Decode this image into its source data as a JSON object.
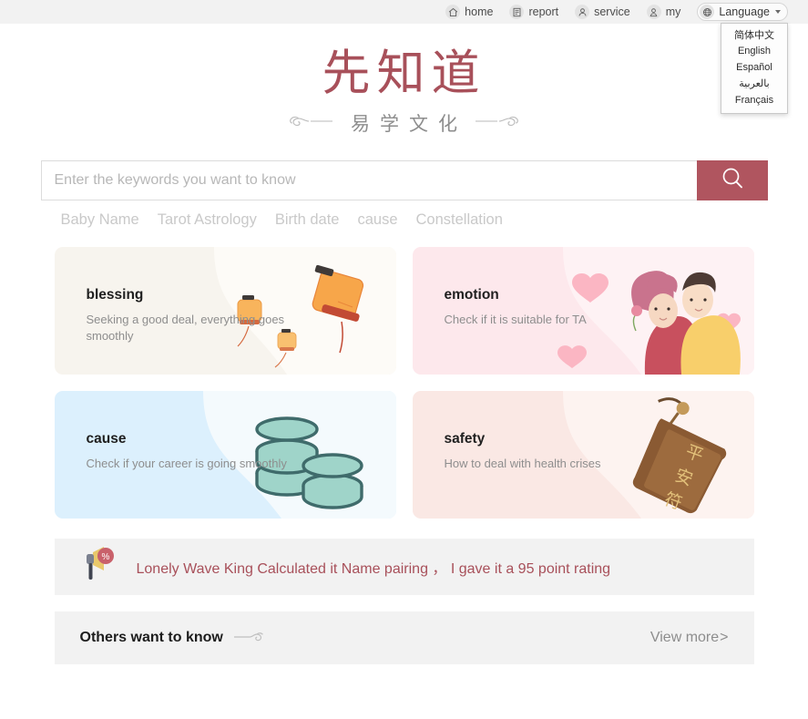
{
  "topnav": {
    "items": [
      {
        "label": "home",
        "icon": "home-icon"
      },
      {
        "label": "report",
        "icon": "report-icon"
      },
      {
        "label": "service",
        "icon": "service-icon"
      },
      {
        "label": "my",
        "icon": "user-icon"
      }
    ],
    "language_button": {
      "label": "Language",
      "icon": "globe-icon",
      "caret": "chevron-down-icon"
    },
    "language_menu": {
      "open": true,
      "options": [
        "简体中文",
        "English",
        "Español",
        "بالعربية",
        "Français"
      ]
    }
  },
  "logo": {
    "main": "先知道",
    "sub": "易学文化",
    "decoration": "cloud-ornament"
  },
  "search": {
    "placeholder": "Enter the keywords you want to know",
    "value": "",
    "button_icon": "search-icon",
    "button_color": "#b0555f"
  },
  "quick_tags": [
    "Baby Name",
    "Tarot Astrology",
    "Birth date",
    "cause",
    "Constellation"
  ],
  "cards": [
    {
      "title": "blessing",
      "desc": "Seeking a good deal, everything goes smoothly",
      "bg": "#f7f4ee",
      "art": "lanterns-illustration"
    },
    {
      "title": "emotion",
      "desc": "Check if it is suitable for TA",
      "bg": "#fde8ec",
      "art": "couple-hearts-illustration"
    },
    {
      "title": "cause",
      "desc": "Check if your career is going smoothly",
      "bg": "#dcf0fd",
      "art": "coin-stacks-illustration"
    },
    {
      "title": "safety",
      "desc": "How to deal with health crises",
      "bg": "#fae8e4",
      "art": "amulet-illustration",
      "art_text": "平安符"
    }
  ],
  "announcement": {
    "icon": "megaphone-percent-icon",
    "text": "Lonely Wave King Calculated it  Name pairing ， I gave it a 95 point rating",
    "color": "#a8505a"
  },
  "others_section": {
    "title": "Others want to know",
    "decoration": "cloud-ornament",
    "view_more": "View more",
    "view_more_arrow": ">"
  }
}
